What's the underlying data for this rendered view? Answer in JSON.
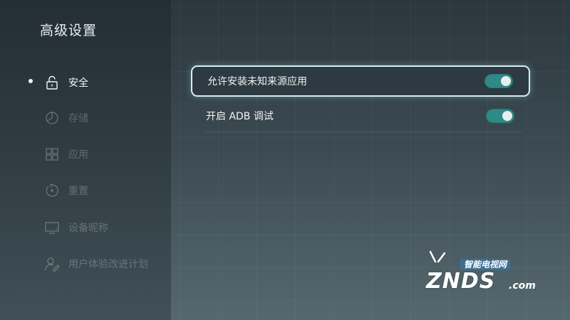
{
  "page_title": "高级设置",
  "sidebar": {
    "items": [
      {
        "label": "安全",
        "icon": "unlock-icon",
        "active": true
      },
      {
        "label": "存储",
        "icon": "pie-chart-icon",
        "active": false
      },
      {
        "label": "应用",
        "icon": "grid-icon",
        "active": false
      },
      {
        "label": "重置",
        "icon": "reset-icon",
        "active": false
      },
      {
        "label": "设备昵称",
        "icon": "monitor-icon",
        "active": false
      },
      {
        "label": "用户体验改进计划",
        "icon": "user-edit-icon",
        "active": false
      }
    ]
  },
  "settings": [
    {
      "label": "允许安装未知来源应用",
      "enabled": true,
      "focused": true
    },
    {
      "label": "开启 ADB 调试",
      "enabled": true,
      "focused": false
    }
  ],
  "watermark": {
    "subtitle": "智能电视网",
    "brand": "ZNDS",
    "suffix": ".com"
  },
  "colors": {
    "toggle_on": "#2f8a86",
    "focus_border": "#d9eef2",
    "text": "#f1f4f5"
  }
}
